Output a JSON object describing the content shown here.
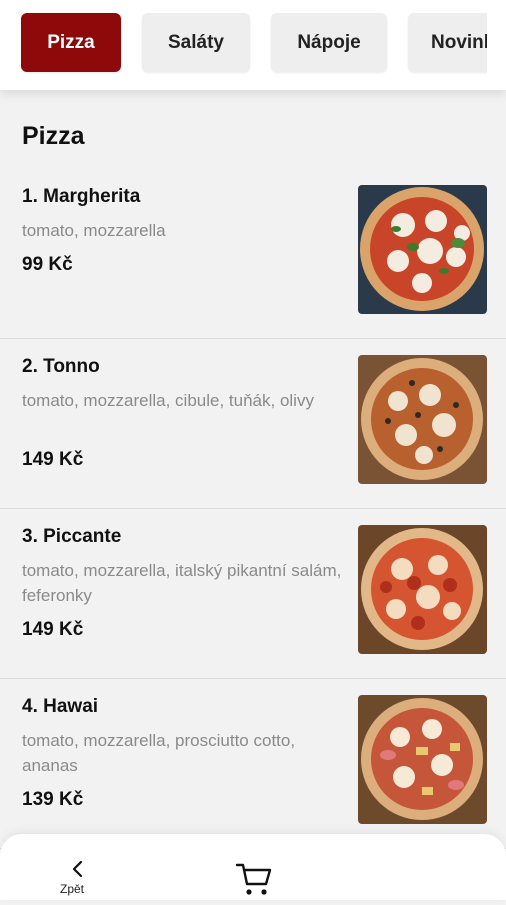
{
  "tabs": [
    {
      "label": "Pizza",
      "active": true
    },
    {
      "label": "Saláty",
      "active": false
    },
    {
      "label": "Nápoje",
      "active": false
    },
    {
      "label": "Novinky",
      "active": false
    }
  ],
  "section": {
    "title": "Pizza"
  },
  "items": [
    {
      "name": "1. Margherita",
      "description": "tomato, mozzarella",
      "price": "99 Kč",
      "image": "margherita-pizza-photo"
    },
    {
      "name": "2. Tonno",
      "description": "tomato, mozzarella, cibule, tuňák, olivy",
      "price": "149 Kč",
      "image": "tonno-pizza-photo"
    },
    {
      "name": "3. Piccante",
      "description": "tomato, mozzarella, italský pikantní salám, feferonky",
      "price": "149 Kč",
      "image": "piccante-pizza-photo"
    },
    {
      "name": "4. Hawai",
      "description": "tomato, mozzarella, prosciutto cotto, ananas",
      "price": "139 Kč",
      "image": "hawai-pizza-photo"
    }
  ],
  "bottom_nav": {
    "back_label": "Zpět",
    "back_icon": "chevron-left-icon",
    "cart_icon": "cart-icon"
  },
  "colors": {
    "accent": "#8e0a0a",
    "tab_bg": "#eeeeee",
    "page_bg": "#f2f2f2"
  }
}
